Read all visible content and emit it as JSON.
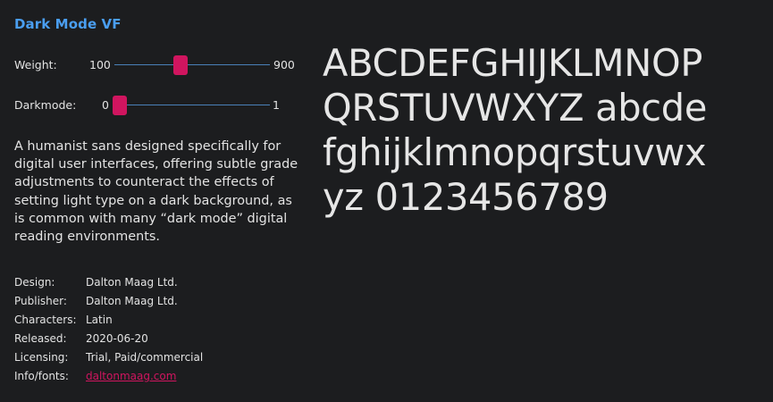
{
  "title": "Dark Mode VF",
  "sliders": {
    "weight": {
      "label": "Weight:",
      "min": "100",
      "max": "900",
      "value_fraction": 0.42
    },
    "darkmode": {
      "label": "Darkmode:",
      "min": "0",
      "max": "1",
      "value_fraction": 0.0
    }
  },
  "description": "A humanist sans designed specifically for digital user interfaces, offering subtle grade adjustments to counteract the effects of setting light type on a dark background, as is common with many “dark mode” digital reading environments.",
  "meta": [
    {
      "key": "Design:",
      "value": "Dalton Maag Ltd."
    },
    {
      "key": "Publisher:",
      "value": "Dalton Maag Ltd."
    },
    {
      "key": "Characters:",
      "value": "Latin"
    },
    {
      "key": "Released:",
      "value": "2020-06-20"
    },
    {
      "key": "Licensing:",
      "value": "Trial, Paid/commercial"
    },
    {
      "key": "Info/fonts:",
      "value": "daltonmaag.com"
    }
  ],
  "specimen": [
    "ABCDEFGHIJKLMNOP",
    "QRSTUVWXYZ abcde",
    "fghijklmnopqrstuvwx",
    "yz 0123456789"
  ],
  "colors": {
    "background": "#1c1d1f",
    "title": "#4a9ef0",
    "accent": "#d0155f",
    "track": "#4a80b8",
    "text": "#e3e3e3"
  }
}
